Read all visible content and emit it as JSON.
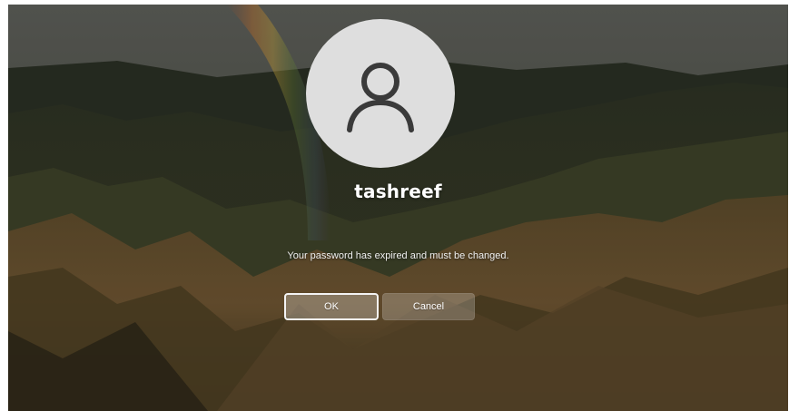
{
  "user": {
    "name": "tashreef",
    "avatar_icon": "user-silhouette-icon"
  },
  "dialog": {
    "message": "Your password has expired and must be changed.",
    "ok_label": "OK",
    "cancel_label": "Cancel"
  },
  "colors": {
    "avatar_bg": "#dedede",
    "avatar_icon": "#3a3a3a",
    "text": "#ffffff"
  }
}
